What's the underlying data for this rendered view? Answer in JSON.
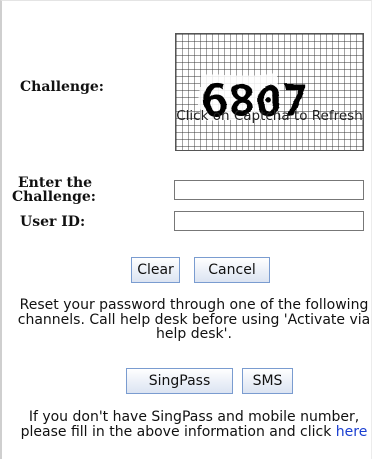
{
  "form": {
    "challenge_label": "Challenge:",
    "captcha": {
      "text": "6807",
      "note": "Click on Captcha to Refresh"
    },
    "enter_challenge_label_line1": "Enter the",
    "enter_challenge_label_line2": "Challenge:",
    "enter_challenge_value": "",
    "user_id_label": "User ID:",
    "user_id_value": ""
  },
  "buttons": {
    "clear": "Clear",
    "cancel": "Cancel",
    "singpass": "SingPass",
    "sms": "SMS"
  },
  "reset_text": "Reset your password through one of the following channels. Call help desk before using 'Activate via help desk'.",
  "footer": {
    "text": "If you don't have SingPass and mobile number, please fill in the above information and click",
    "link": "here"
  },
  "colors": {
    "link": "#1a3fd1",
    "button_border": "#7a9cd0"
  }
}
